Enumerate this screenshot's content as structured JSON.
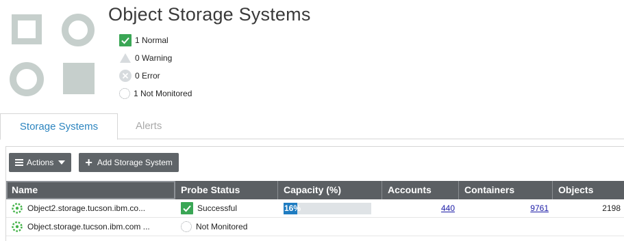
{
  "header": {
    "title": "Object Storage Systems",
    "status_summary": [
      {
        "icon": "green-check-icon",
        "label": "1 Normal"
      },
      {
        "icon": "warning-triangle-icon",
        "label": "0 Warning"
      },
      {
        "icon": "error-x-icon",
        "label": "0 Error"
      },
      {
        "icon": "not-monitored-icon",
        "label": "1 Not Monitored"
      }
    ]
  },
  "tabs": [
    {
      "label": "Storage Systems",
      "active": true
    },
    {
      "label": "Alerts",
      "active": false
    }
  ],
  "toolbar": {
    "actions_label": "Actions",
    "add_label": "Add Storage System"
  },
  "table": {
    "columns": [
      "Name",
      "Probe Status",
      "Capacity (%)",
      "Accounts",
      "Containers",
      "Objects"
    ],
    "rows": [
      {
        "name": "Object2.storage.tucson.ibm.co...",
        "probe_status": "Successful",
        "probe_icon": "green-check-icon",
        "capacity_label": "16%",
        "capacity_fraction": 0.16,
        "accounts": "440",
        "containers": "9761",
        "objects": "2198"
      },
      {
        "name": "Object.storage.tucson.ibm.com ...",
        "probe_status": "Not Monitored",
        "probe_icon": "not-monitored-icon",
        "capacity_label": "",
        "capacity_fraction": null,
        "accounts": "",
        "containers": "",
        "objects": ""
      }
    ]
  },
  "colors": {
    "accent": "#2b84bf",
    "success": "#3aa655",
    "header_bg": "#5b5f63",
    "capacity_fill": "#1f7cc1"
  }
}
